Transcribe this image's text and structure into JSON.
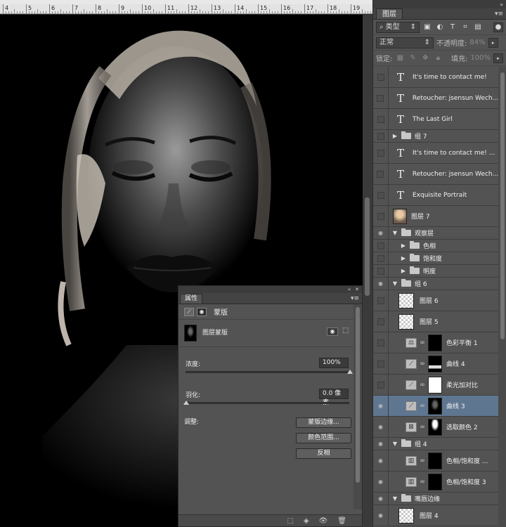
{
  "ruler": {
    "labels": [
      "4",
      "5",
      "6",
      "7",
      "8",
      "9",
      "10",
      "11",
      "12",
      "13",
      "14",
      "15",
      "16",
      "17",
      "18",
      "19"
    ]
  },
  "layers_panel": {
    "tab_label": "图层",
    "menu_icon": "panel-menu-icon",
    "filter": {
      "kind_label": "类型",
      "search_icon": "search-icon"
    },
    "blend_mode": "正常",
    "opacity_label": "不透明度:",
    "opacity_value": "84%",
    "lock_label": "锁定:",
    "fill_label": "填充:",
    "fill_value": "100%",
    "layers": [
      {
        "name": "It's time to contact me!",
        "type": "text",
        "visible": false
      },
      {
        "name": "Retoucher: jsensun Wech...",
        "type": "text",
        "visible": false
      },
      {
        "name": "The Last Girl",
        "type": "text",
        "visible": false
      },
      {
        "name": "组 7",
        "type": "group",
        "visible": false,
        "expanded": false
      },
      {
        "name": "It's time to contact me! ...",
        "type": "text",
        "visible": false
      },
      {
        "name": "Retoucher: jsensun Wech...",
        "type": "text",
        "visible": false
      },
      {
        "name": "Exquisite Portrait",
        "type": "text",
        "visible": false
      },
      {
        "name": "图层 7",
        "type": "image",
        "visible": false
      },
      {
        "name": "观察层",
        "type": "group",
        "visible": true,
        "expanded": true
      },
      {
        "name": "色相",
        "type": "group",
        "visible": false,
        "expanded": false,
        "indent": true
      },
      {
        "name": "饱和度",
        "type": "group",
        "visible": false,
        "expanded": false,
        "indent": true
      },
      {
        "name": "明度",
        "type": "group",
        "visible": false,
        "expanded": false,
        "indent": true
      },
      {
        "name": "组 6",
        "type": "group",
        "visible": true,
        "expanded": true
      },
      {
        "name": "图层 6",
        "type": "pixel",
        "visible": false
      },
      {
        "name": "图层 5",
        "type": "pixel",
        "visible": false
      },
      {
        "name": "色彩平衡 1",
        "type": "adjust",
        "adj_icon": "balance-icon",
        "mask": "black",
        "visible": false
      },
      {
        "name": "曲线 4",
        "type": "adjust",
        "adj_icon": "curves-icon",
        "mask": "line",
        "visible": false
      },
      {
        "name": "柔光加对比",
        "type": "adjust",
        "adj_icon": "curves-icon",
        "mask": "white",
        "visible": false
      },
      {
        "name": "曲线 3",
        "type": "adjust",
        "adj_icon": "curves-icon",
        "mask": "face",
        "visible": true,
        "selected": true
      },
      {
        "name": "选取颜色 2",
        "type": "adjust",
        "adj_icon": "selective-color-icon",
        "mask": "fig",
        "visible": true
      },
      {
        "name": "组 4",
        "type": "group",
        "visible": true,
        "expanded": true
      },
      {
        "name": "色相/饱和度 ...",
        "type": "adjust",
        "adj_icon": "hue-saturation-icon",
        "mask": "black",
        "visible": true
      },
      {
        "name": "色相/饱和度 3",
        "type": "adjust",
        "adj_icon": "hue-saturation-icon",
        "mask": "black",
        "visible": true
      },
      {
        "name": "嘴唇边缘",
        "type": "group",
        "visible": true,
        "expanded": true
      },
      {
        "name": "图层 4",
        "type": "pixel",
        "visible": true
      }
    ]
  },
  "properties": {
    "tab_label": "属性",
    "section_title": "蒙版",
    "mask_label": "图层蒙版",
    "density_label": "浓度:",
    "density_value": "100%",
    "density_level": 1.0,
    "feather_label": "羽化:",
    "feather_value": "0.0 像素",
    "feather_level": 0.0,
    "refine_label": "调整:",
    "buttons": [
      "蒙版边缘...",
      "颜色范围...",
      "反相"
    ]
  },
  "colors": {
    "selected_row": "#5f7690",
    "panel_bg": "#535353"
  }
}
